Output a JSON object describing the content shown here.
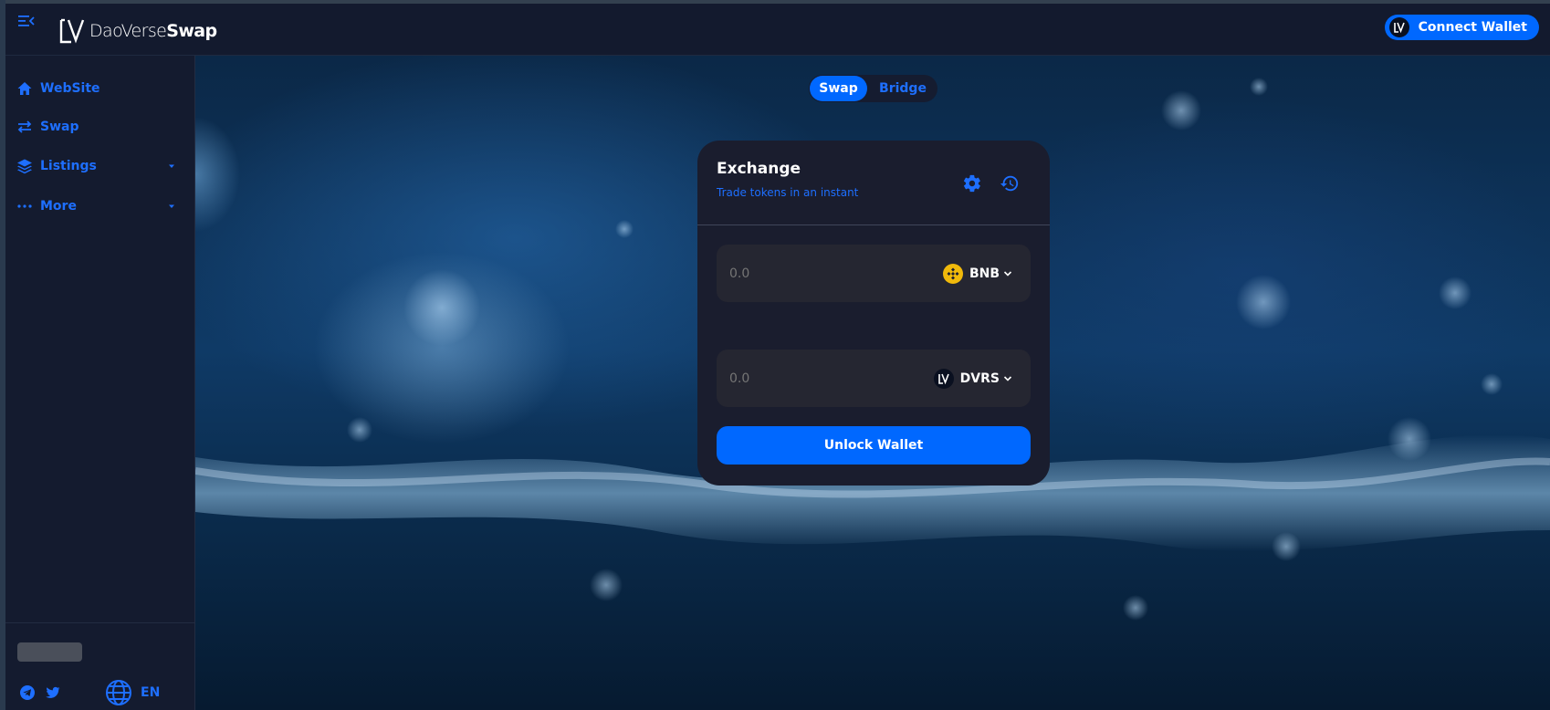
{
  "header": {
    "logo_text_light": "DaoVerse",
    "logo_text_bold": "Swap",
    "logo_mark_letters": "LV",
    "connect_wallet_label": "Connect Wallet"
  },
  "sidebar": {
    "items": [
      {
        "label": "WebSite",
        "icon": "home-icon"
      },
      {
        "label": "Swap",
        "icon": "swap-arrows-icon"
      },
      {
        "label": "Listings",
        "icon": "layers-icon",
        "expandable": true
      },
      {
        "label": "More",
        "icon": "more-dots-icon",
        "expandable": true
      }
    ],
    "footer": {
      "socials": [
        "telegram-icon",
        "twitter-icon"
      ],
      "language_icon": "globe-icon",
      "language": "EN"
    }
  },
  "toggle": {
    "options": [
      "Swap",
      "Bridge"
    ],
    "selected": "Swap"
  },
  "exchange": {
    "title": "Exchange",
    "subtitle": "Trade tokens in an instant",
    "from": {
      "amount": "0.0",
      "token": "BNB",
      "token_icon": "bnb-icon"
    },
    "to": {
      "amount": "0.0",
      "token": "DVRS",
      "token_icon": "dvrs-icon"
    },
    "unlock_label": "Unlock Wallet"
  },
  "colors": {
    "accent": "#0068ff",
    "link_blue": "#1e6fff",
    "header_bg": "#131a2e",
    "card_bg": "#1a1d2e",
    "field_bg": "#252631",
    "bnb_yellow": "#f0b90b"
  }
}
